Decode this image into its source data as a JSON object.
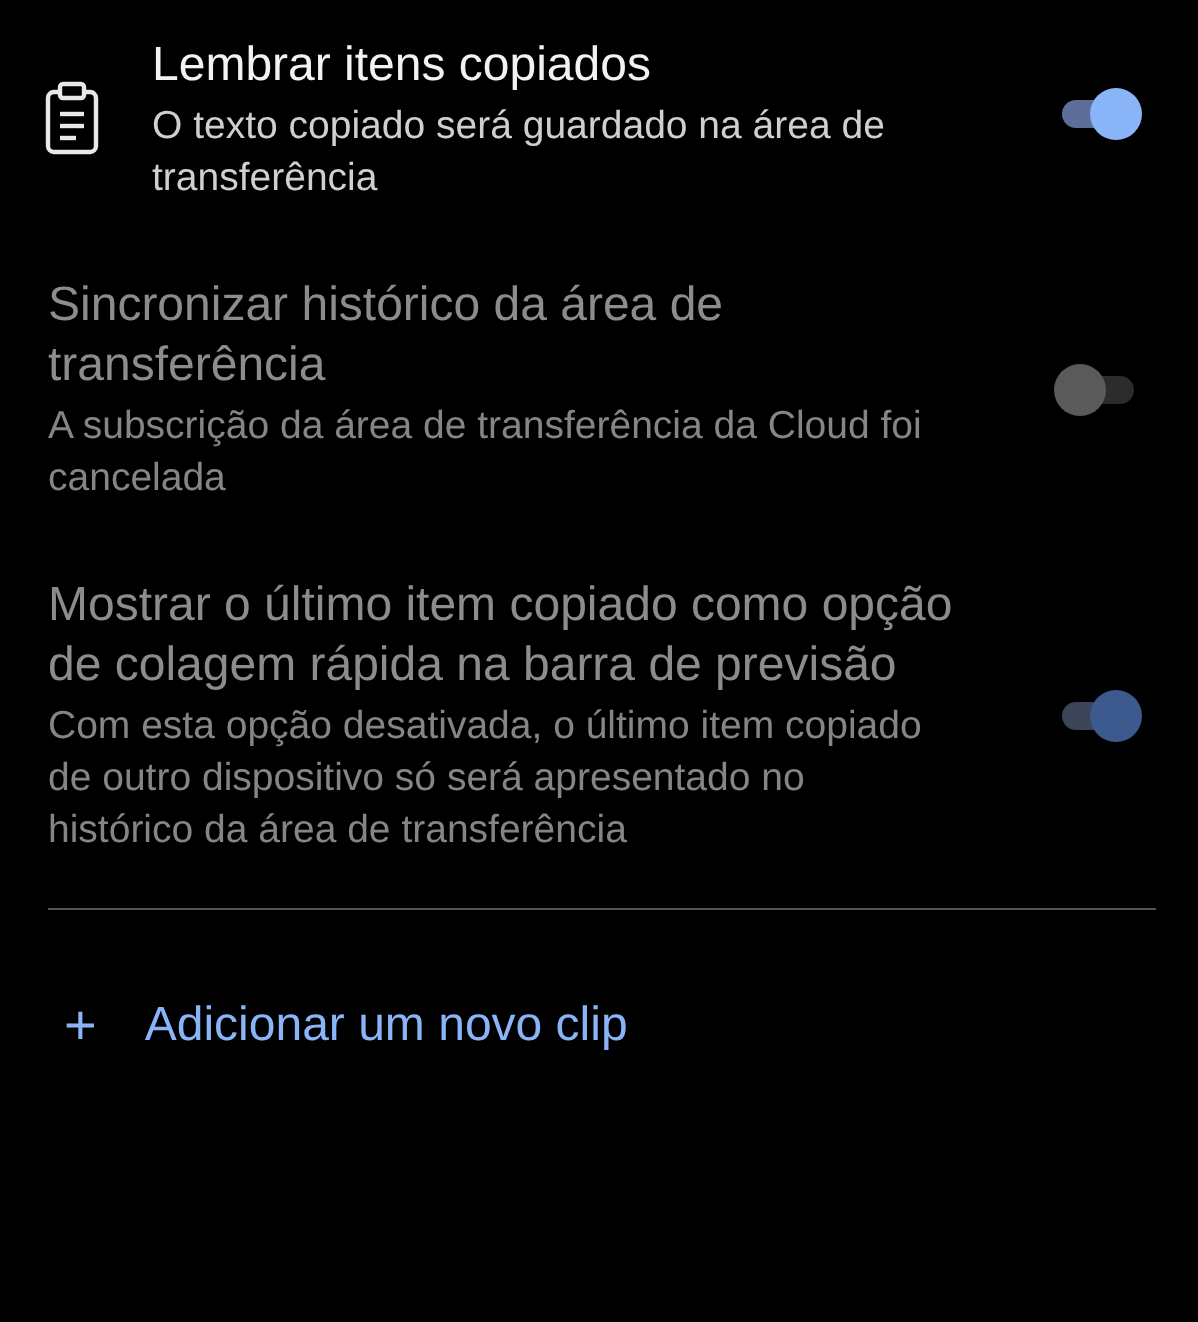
{
  "settings": [
    {
      "kind": "icon",
      "title": "Lembrar itens copiados",
      "subtitle": "O texto copiado será guardado na área de transferência",
      "on": true,
      "disabled": false
    },
    {
      "kind": "plain",
      "title": "Sincronizar histórico da área de transferência",
      "subtitle": "A subscrição da área de transferência da Cloud foi cancelada",
      "on": false,
      "disabled": true
    },
    {
      "kind": "plain",
      "title": "Mostrar o último item copiado como opção de colagem rápida na barra de previsão",
      "subtitle": "Com esta opção desativada, o último item copiado de outro dispositivo só será apresentado no histórico da área de transferência",
      "on": true,
      "disabled": true
    }
  ],
  "add_action": {
    "icon": "+",
    "label": "Adicionar um novo clip"
  }
}
